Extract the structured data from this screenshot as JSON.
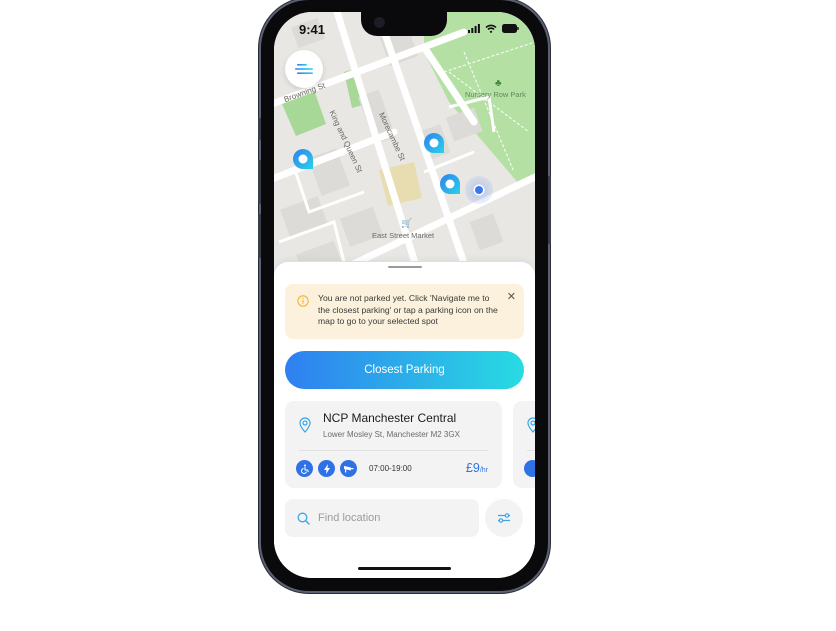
{
  "status_bar": {
    "time": "9:41"
  },
  "map": {
    "streets": [
      "Browning St",
      "King and Queen St",
      "Morecambe St"
    ],
    "parks": [
      "Nursery Row Park"
    ],
    "places": [
      "East Street Market"
    ],
    "parking_pins": 3
  },
  "alert": {
    "message": "You are not parked yet. Click 'Navigate me to the closest parking' or tap a parking icon on the map to go to your selected spot",
    "close_label": "✕"
  },
  "cta": {
    "label": "Closest Parking"
  },
  "parking_cards": [
    {
      "name": "NCP Manchester Central",
      "address": "Lower Mosley St, Manchester M2 3GX",
      "features": [
        "wheelchair-icon",
        "ev-charging-icon",
        "cctv-icon"
      ],
      "hours": "07:00-19:00",
      "price": "£9",
      "price_unit": "/hr"
    }
  ],
  "search": {
    "placeholder": "Find location",
    "value": ""
  },
  "colors": {
    "accent": "#2f72e6",
    "gradient_start": "#2f7ff0",
    "gradient_end": "#28dbe2",
    "alert_bg": "#fbf1dc",
    "alert_icon": "#f2b43a"
  }
}
